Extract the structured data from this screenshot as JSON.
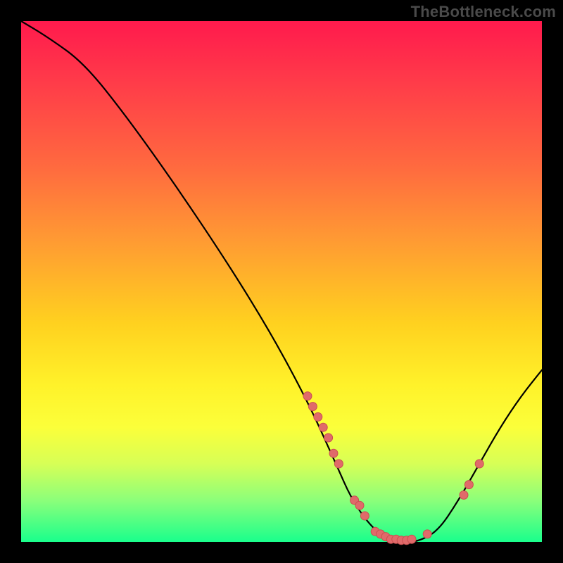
{
  "watermark": "TheBottleneck.com",
  "chart_data": {
    "type": "line",
    "title": "",
    "xlabel": "",
    "ylabel": "",
    "xlim": [
      0,
      100
    ],
    "ylim": [
      0,
      100
    ],
    "curve": {
      "x": [
        0,
        5,
        12,
        20,
        30,
        40,
        48,
        55,
        60,
        64,
        69,
        73,
        76,
        80,
        84,
        88,
        92,
        96,
        100
      ],
      "y": [
        100,
        97,
        92,
        82,
        68,
        53,
        40,
        27,
        16,
        7,
        1,
        0,
        0,
        2,
        8,
        15,
        22,
        28,
        33
      ]
    },
    "markers": {
      "x": [
        55,
        56,
        57,
        58,
        59,
        60,
        61,
        64,
        65,
        66,
        68,
        69,
        70,
        71,
        72,
        73,
        74,
        75,
        78,
        85,
        86,
        88
      ],
      "y": [
        28,
        26,
        24,
        22,
        20,
        17,
        15,
        8,
        7,
        5,
        2,
        1.5,
        1,
        0.5,
        0.5,
        0.3,
        0.3,
        0.5,
        1.5,
        9,
        11,
        15
      ]
    },
    "gradient_stops": [
      {
        "pct": 0,
        "color": "#ff1a4d"
      },
      {
        "pct": 50,
        "color": "#ffd11f"
      },
      {
        "pct": 100,
        "color": "#1aff8c"
      }
    ]
  }
}
